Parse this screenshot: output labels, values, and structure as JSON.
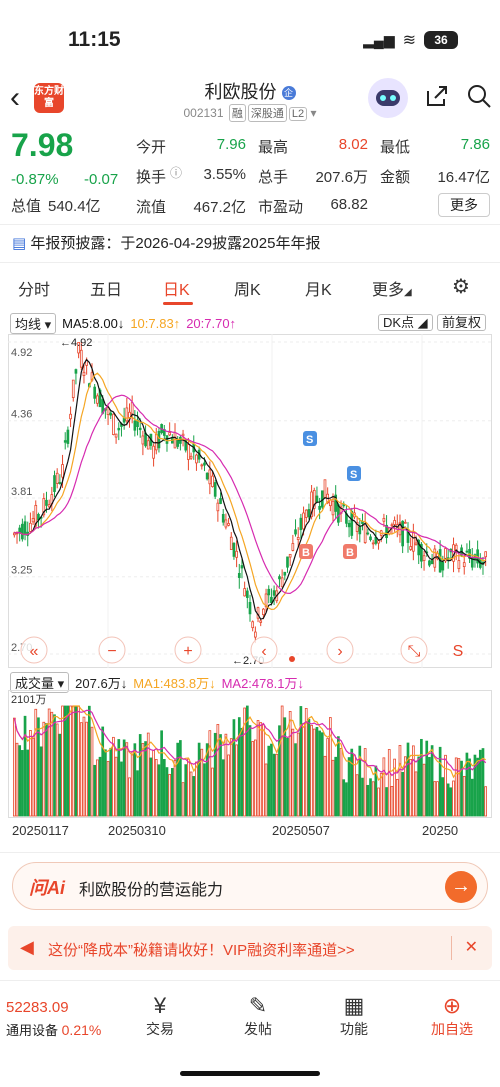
{
  "status": {
    "time": "11:15",
    "battery": "36"
  },
  "header": {
    "logo_text": "东方财富",
    "title": "利欧股份",
    "code": "002131",
    "tags": [
      "融",
      "深股通",
      "L2"
    ]
  },
  "quote": {
    "price": "7.98",
    "change_pct": "-0.87%",
    "change": "-0.07",
    "rows": [
      [
        {
          "label": "今开",
          "value": "7.96"
        },
        {
          "label": "最高",
          "value": "8.02"
        },
        {
          "label": "最低",
          "value": "7.86"
        }
      ],
      [
        {
          "label": "换手",
          "value": "3.55%"
        },
        {
          "label": "总手",
          "value": "207.6万"
        },
        {
          "label": "金额",
          "value": "16.47亿"
        }
      ],
      [
        {
          "label": "流值",
          "value": "467.2亿"
        },
        {
          "label": "市盈动",
          "value": "68.82"
        }
      ]
    ],
    "total_label": "总值",
    "total_value": "540.4亿",
    "more": "更多"
  },
  "notice": "年报预披露：于2026-04-29披露2025年年报",
  "tabs": [
    "分时",
    "五日",
    "日K",
    "周K",
    "月K",
    "更多"
  ],
  "legend": {
    "ma_select": "均线",
    "ma5": "MA5:8.00↓",
    "ma10": "10:7.83↑",
    "ma20": "20:7.70↑",
    "dk": "DK点",
    "fq": "前复权"
  },
  "chart_data": {
    "type": "candlestick",
    "ylim": [
      2.7,
      4.92
    ],
    "y_ticks": [
      "4.92",
      "4.36",
      "3.81",
      "3.25",
      "2.70"
    ],
    "max_label": "4.92",
    "min_label": "2.70",
    "x_labels": [
      "20250117",
      "20250310",
      "20250507",
      "20250"
    ],
    "controls": [
      "«",
      "−",
      "+",
      "‹",
      "›",
      "⤡",
      "S"
    ],
    "markers": [
      "S",
      "S",
      "B",
      "B"
    ],
    "volume": {
      "label": "成交量",
      "value": "207.6万↓",
      "ma1": "MA1:483.8万↓",
      "ma2": "MA2:478.1万↓",
      "max_label": "2101万"
    }
  },
  "ask": {
    "logo": "问Ai",
    "text": "利欧股份的营运能力"
  },
  "banner": {
    "text": "这份“降成本”秘籍请收好！VIP融资利率通道>>"
  },
  "bottom_nav": [
    {
      "label": "交易",
      "icon": "¥"
    },
    {
      "label": "发帖",
      "icon": "✎"
    },
    {
      "label": "功能",
      "icon": "▦"
    },
    {
      "label": "加自选",
      "icon": "⊕"
    }
  ],
  "index": {
    "value": "52283.09",
    "name": "通用设备",
    "pct": "0.21%"
  },
  "colors": {
    "up": "#e8462b",
    "down": "#18a34a",
    "ma5": "#111111",
    "ma10": "#f5a623",
    "ma20": "#d62bb0"
  }
}
